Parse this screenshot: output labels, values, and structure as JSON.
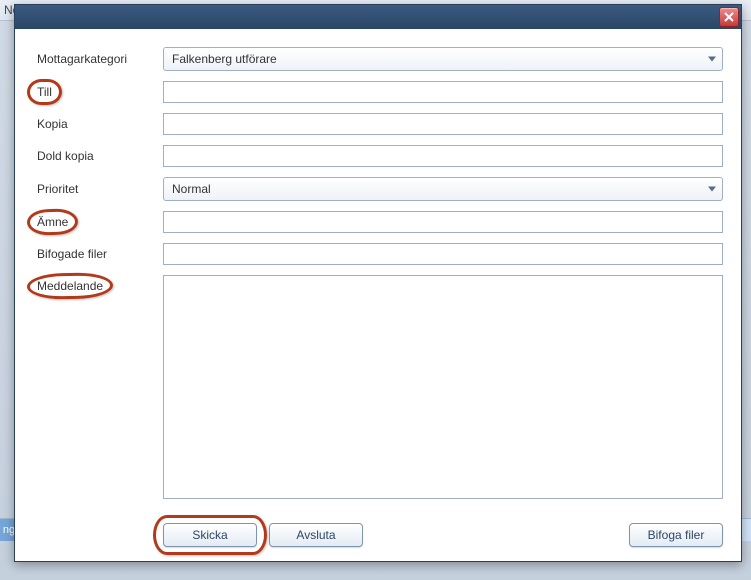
{
  "background": {
    "top_fragment": "No",
    "bottom_fragment": "ng"
  },
  "dialog": {
    "close_label": "Close"
  },
  "form": {
    "category": {
      "label": "Mottagarkategori",
      "value": "Falkenberg utförare"
    },
    "to": {
      "label": "Till",
      "value": ""
    },
    "cc": {
      "label": "Kopia",
      "value": ""
    },
    "bcc": {
      "label": "Dold kopia",
      "value": ""
    },
    "priority": {
      "label": "Prioritet",
      "value": "Normal"
    },
    "subject": {
      "label": "Ämne",
      "value": ""
    },
    "attachments": {
      "label": "Bifogade filer",
      "value": ""
    },
    "message": {
      "label": "Meddelande",
      "value": ""
    }
  },
  "buttons": {
    "send": "Skicka",
    "close": "Avsluta",
    "attach": "Bifoga filer"
  }
}
